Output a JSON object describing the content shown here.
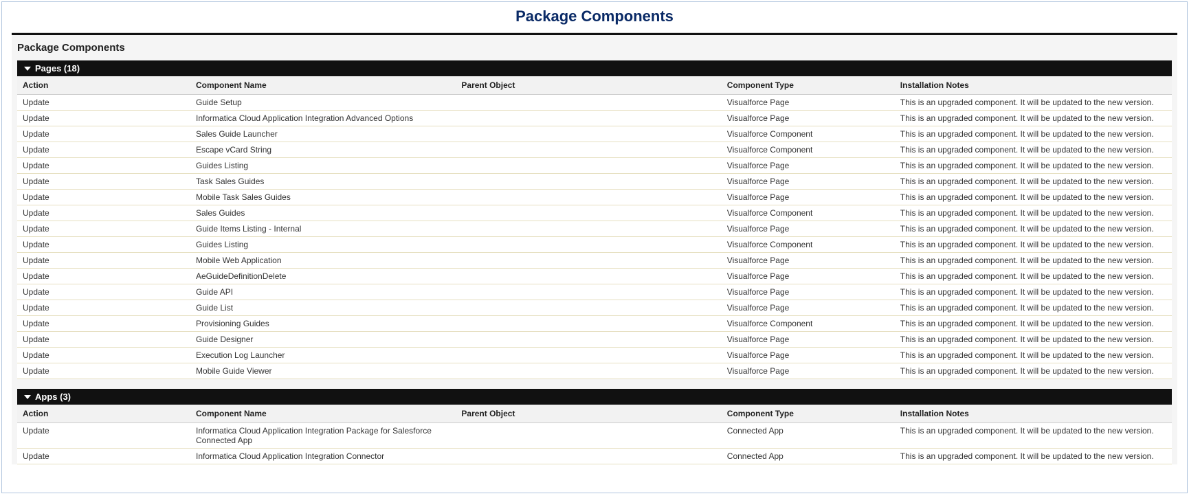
{
  "main_title": "Package Components",
  "panel_title": "Package Components",
  "columns": {
    "action": "Action",
    "name": "Component Name",
    "parent": "Parent Object",
    "type": "Component Type",
    "notes": "Installation Notes"
  },
  "sections": [
    {
      "title": "Pages (18)",
      "rows": [
        {
          "action": "Update",
          "name": "Guide Setup",
          "parent": "",
          "type": "Visualforce Page",
          "notes": "This is an upgraded component. It will be updated to the new version."
        },
        {
          "action": "Update",
          "name": "Informatica Cloud Application Integration Advanced Options",
          "parent": "",
          "type": "Visualforce Page",
          "notes": "This is an upgraded component. It will be updated to the new version."
        },
        {
          "action": "Update",
          "name": "Sales Guide Launcher",
          "parent": "",
          "type": "Visualforce Component",
          "notes": "This is an upgraded component. It will be updated to the new version."
        },
        {
          "action": "Update",
          "name": "Escape vCard String",
          "parent": "",
          "type": "Visualforce Component",
          "notes": "This is an upgraded component. It will be updated to the new version."
        },
        {
          "action": "Update",
          "name": "Guides Listing",
          "parent": "",
          "type": "Visualforce Page",
          "notes": "This is an upgraded component. It will be updated to the new version."
        },
        {
          "action": "Update",
          "name": "Task Sales Guides",
          "parent": "",
          "type": "Visualforce Page",
          "notes": "This is an upgraded component. It will be updated to the new version."
        },
        {
          "action": "Update",
          "name": "Mobile Task Sales Guides",
          "parent": "",
          "type": "Visualforce Page",
          "notes": "This is an upgraded component. It will be updated to the new version."
        },
        {
          "action": "Update",
          "name": "Sales Guides",
          "parent": "",
          "type": "Visualforce Component",
          "notes": "This is an upgraded component. It will be updated to the new version."
        },
        {
          "action": "Update",
          "name": "Guide Items Listing - Internal",
          "parent": "",
          "type": "Visualforce Page",
          "notes": "This is an upgraded component. It will be updated to the new version."
        },
        {
          "action": "Update",
          "name": "Guides Listing",
          "parent": "",
          "type": "Visualforce Component",
          "notes": "This is an upgraded component. It will be updated to the new version."
        },
        {
          "action": "Update",
          "name": "Mobile Web Application",
          "parent": "",
          "type": "Visualforce Page",
          "notes": "This is an upgraded component. It will be updated to the new version."
        },
        {
          "action": "Update",
          "name": "AeGuideDefinitionDelete",
          "parent": "",
          "type": "Visualforce Page",
          "notes": "This is an upgraded component. It will be updated to the new version."
        },
        {
          "action": "Update",
          "name": "Guide API",
          "parent": "",
          "type": "Visualforce Page",
          "notes": "This is an upgraded component. It will be updated to the new version."
        },
        {
          "action": "Update",
          "name": "Guide List",
          "parent": "",
          "type": "Visualforce Page",
          "notes": "This is an upgraded component. It will be updated to the new version."
        },
        {
          "action": "Update",
          "name": "Provisioning Guides",
          "parent": "",
          "type": "Visualforce Component",
          "notes": "This is an upgraded component. It will be updated to the new version."
        },
        {
          "action": "Update",
          "name": "Guide Designer",
          "parent": "",
          "type": "Visualforce Page",
          "notes": "This is an upgraded component. It will be updated to the new version."
        },
        {
          "action": "Update",
          "name": "Execution Log Launcher",
          "parent": "",
          "type": "Visualforce Page",
          "notes": "This is an upgraded component. It will be updated to the new version."
        },
        {
          "action": "Update",
          "name": "Mobile Guide Viewer",
          "parent": "",
          "type": "Visualforce Page",
          "notes": "This is an upgraded component. It will be updated to the new version."
        }
      ]
    },
    {
      "title": "Apps (3)",
      "rows": [
        {
          "action": "Update",
          "name": "Informatica Cloud Application Integration Package for Salesforce Connected App",
          "parent": "",
          "type": "Connected App",
          "notes": "This is an upgraded component. It will be updated to the new version."
        },
        {
          "action": "Update",
          "name": "Informatica Cloud Application Integration Connector",
          "parent": "",
          "type": "Connected App",
          "notes": "This is an upgraded component. It will be updated to the new version."
        }
      ]
    }
  ]
}
